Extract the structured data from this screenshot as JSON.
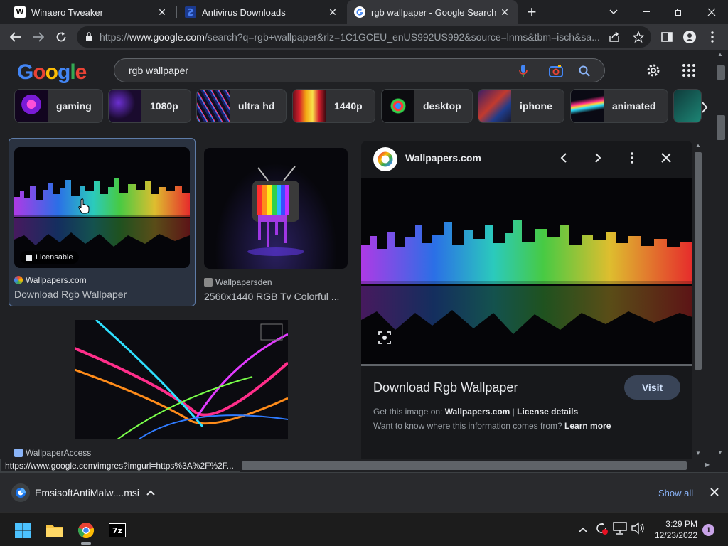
{
  "browser": {
    "tabs": [
      {
        "title": "Winaero Tweaker",
        "favicon": "W"
      },
      {
        "title": "Antivirus Downloads",
        "favicon": ""
      },
      {
        "title": "rgb wallpaper - Google Search",
        "favicon": "G"
      }
    ],
    "new_tab": "+",
    "url_host": "www.google.com",
    "url_prefix": "https://",
    "url_rest": "/search?q=rgb+wallpaper&rlz=1C1GCEU_enUS992US992&source=lnms&tbm=isch&sa..."
  },
  "google": {
    "logo_letters": [
      "G",
      "o",
      "o",
      "g",
      "l",
      "e"
    ],
    "logo_colors": [
      "#4285f4",
      "#ea4335",
      "#fbbc05",
      "#4285f4",
      "#34a853",
      "#ea4335"
    ],
    "query": "rgb wallpaper",
    "chips": [
      "gaming",
      "1080p",
      "ultra hd",
      "1440p",
      "desktop",
      "iphone",
      "animated"
    ]
  },
  "results": [
    {
      "source": "Wallpapers.com",
      "caption": "Download Rgb Wallpaper",
      "badge": "Licensable"
    },
    {
      "source": "Wallpapersden",
      "caption": "2560x1440 RGB Tv Colorful ..."
    },
    {
      "source": "WallpaperAccess",
      "caption": ""
    }
  ],
  "preview": {
    "source": "Wallpapers.com",
    "title": "Download Rgb Wallpaper",
    "visit": "Visit",
    "get_image_prefix": "Get this image on:",
    "get_image_site": "Wallpapers.com",
    "separator": "|",
    "license": "License details",
    "info_question": "Want to know where this information comes from?",
    "learn_more": "Learn more"
  },
  "status_url": "https://www.google.com/imgres?imgurl=https%3A%2F%2F...",
  "downloads": {
    "file": "EmsisoftAntiMalw....msi",
    "show_all": "Show all"
  },
  "taskbar": {
    "time": "3:29 PM",
    "date": "12/23/2022",
    "notification_count": "1",
    "sevenzip_label": "7z"
  },
  "colors": {
    "accent_blue": "#8ab4f8",
    "visit_bg": "#394457"
  }
}
